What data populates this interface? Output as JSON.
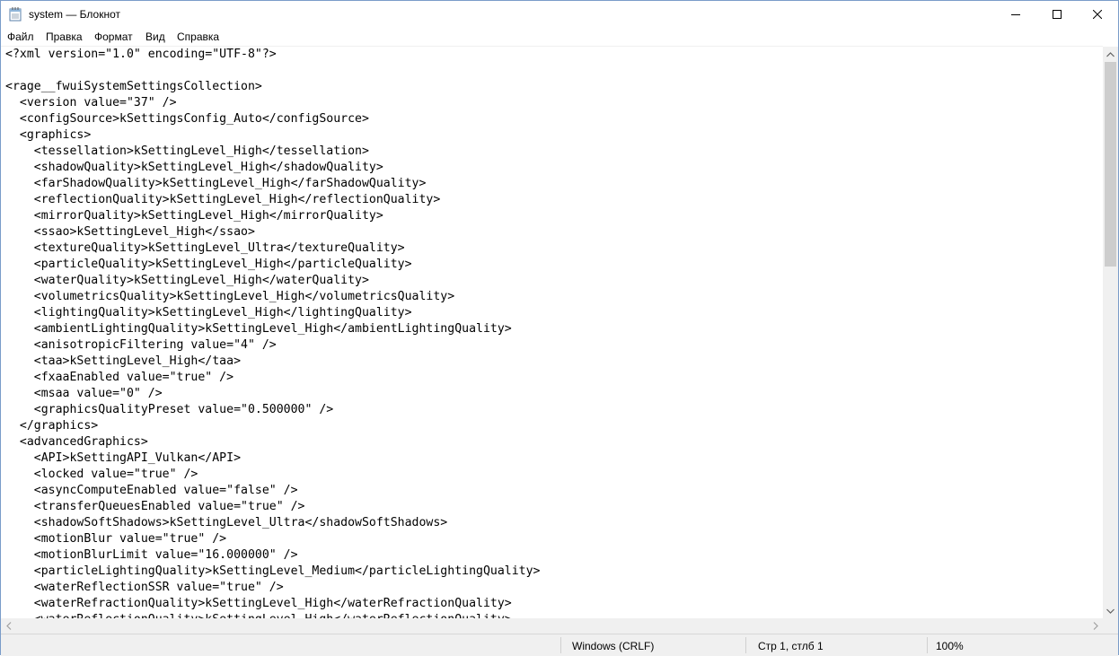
{
  "window": {
    "title": "system — Блокнот"
  },
  "menu": {
    "items": [
      {
        "label": "Файл"
      },
      {
        "label": "Правка"
      },
      {
        "label": "Формат"
      },
      {
        "label": "Вид"
      },
      {
        "label": "Справка"
      }
    ]
  },
  "editor": {
    "lines": [
      "<?xml version=\"1.0\" encoding=\"UTF-8\"?>",
      "",
      "<rage__fwuiSystemSettingsCollection>",
      "  <version value=\"37\" />",
      "  <configSource>kSettingsConfig_Auto</configSource>",
      "  <graphics>",
      "    <tessellation>kSettingLevel_High</tessellation>",
      "    <shadowQuality>kSettingLevel_High</shadowQuality>",
      "    <farShadowQuality>kSettingLevel_High</farShadowQuality>",
      "    <reflectionQuality>kSettingLevel_High</reflectionQuality>",
      "    <mirrorQuality>kSettingLevel_High</mirrorQuality>",
      "    <ssao>kSettingLevel_High</ssao>",
      "    <textureQuality>kSettingLevel_Ultra</textureQuality>",
      "    <particleQuality>kSettingLevel_High</particleQuality>",
      "    <waterQuality>kSettingLevel_High</waterQuality>",
      "    <volumetricsQuality>kSettingLevel_High</volumetricsQuality>",
      "    <lightingQuality>kSettingLevel_High</lightingQuality>",
      "    <ambientLightingQuality>kSettingLevel_High</ambientLightingQuality>",
      "    <anisotropicFiltering value=\"4\" />",
      "    <taa>kSettingLevel_High</taa>",
      "    <fxaaEnabled value=\"true\" />",
      "    <msaa value=\"0\" />",
      "    <graphicsQualityPreset value=\"0.500000\" />",
      "  </graphics>",
      "  <advancedGraphics>",
      "    <API>kSettingAPI_Vulkan</API>",
      "    <locked value=\"true\" />",
      "    <asyncComputeEnabled value=\"false\" />",
      "    <transferQueuesEnabled value=\"true\" />",
      "    <shadowSoftShadows>kSettingLevel_Ultra</shadowSoftShadows>",
      "    <motionBlur value=\"true\" />",
      "    <motionBlurLimit value=\"16.000000\" />",
      "    <particleLightingQuality>kSettingLevel_Medium</particleLightingQuality>",
      "    <waterReflectionSSR value=\"true\" />",
      "    <waterRefractionQuality>kSettingLevel_High</waterRefractionQuality>",
      "    <waterReflectionQuality>kSettingLevel_High</waterReflectionQuality>"
    ]
  },
  "status": {
    "encoding": "Windows (CRLF)",
    "position": "Стр 1, стлб 1",
    "zoom": "100%"
  }
}
